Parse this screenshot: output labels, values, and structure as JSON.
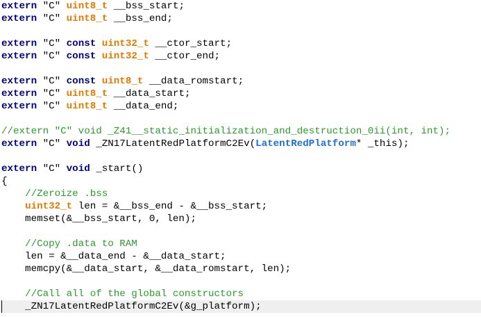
{
  "editor": {
    "current_line": 24,
    "lines": [
      [
        {
          "t": "extern",
          "c": "kw"
        },
        {
          "t": " \"C\" ",
          "c": "str"
        },
        {
          "t": "uint8_t",
          "c": "type"
        },
        {
          "t": " __bss_start;",
          "c": "plain"
        }
      ],
      [
        {
          "t": "extern",
          "c": "kw"
        },
        {
          "t": " \"C\" ",
          "c": "str"
        },
        {
          "t": "uint8_t",
          "c": "type"
        },
        {
          "t": " __bss_end;",
          "c": "plain"
        }
      ],
      [],
      [
        {
          "t": "extern",
          "c": "kw"
        },
        {
          "t": " \"C\" ",
          "c": "str"
        },
        {
          "t": "const",
          "c": "kw"
        },
        {
          "t": " ",
          "c": "plain"
        },
        {
          "t": "uint32_t",
          "c": "type"
        },
        {
          "t": " __ctor_start;",
          "c": "plain"
        }
      ],
      [
        {
          "t": "extern",
          "c": "kw"
        },
        {
          "t": " \"C\" ",
          "c": "str"
        },
        {
          "t": "const",
          "c": "kw"
        },
        {
          "t": " ",
          "c": "plain"
        },
        {
          "t": "uint32_t",
          "c": "type"
        },
        {
          "t": " __ctor_end;",
          "c": "plain"
        }
      ],
      [],
      [
        {
          "t": "extern",
          "c": "kw"
        },
        {
          "t": " \"C\" ",
          "c": "str"
        },
        {
          "t": "const",
          "c": "kw"
        },
        {
          "t": " ",
          "c": "plain"
        },
        {
          "t": "uint8_t",
          "c": "type"
        },
        {
          "t": " __data_romstart;",
          "c": "plain"
        }
      ],
      [
        {
          "t": "extern",
          "c": "kw"
        },
        {
          "t": " \"C\" ",
          "c": "str"
        },
        {
          "t": "uint8_t",
          "c": "type"
        },
        {
          "t": " __data_start;",
          "c": "plain"
        }
      ],
      [
        {
          "t": "extern",
          "c": "kw"
        },
        {
          "t": " \"C\" ",
          "c": "str"
        },
        {
          "t": "uint8_t",
          "c": "type"
        },
        {
          "t": " __data_end;",
          "c": "plain"
        }
      ],
      [],
      [
        {
          "t": "//extern \"C\" void _Z41__static_initialization_and_destruction_0ii(int, int);",
          "c": "com"
        }
      ],
      [
        {
          "t": "extern",
          "c": "kw"
        },
        {
          "t": " \"C\" ",
          "c": "str"
        },
        {
          "t": "void",
          "c": "kw"
        },
        {
          "t": " _ZN17LatentRedPlatformC2Ev(",
          "c": "plain"
        },
        {
          "t": "LatentRedPlatform",
          "c": "cls"
        },
        {
          "t": "* _this);",
          "c": "plain"
        }
      ],
      [],
      [
        {
          "t": "extern",
          "c": "kw"
        },
        {
          "t": " \"C\" ",
          "c": "str"
        },
        {
          "t": "void",
          "c": "kw"
        },
        {
          "t": " _start()",
          "c": "plain"
        }
      ],
      [
        {
          "t": "{",
          "c": "plain"
        }
      ],
      [
        {
          "t": "    ",
          "c": "plain"
        },
        {
          "t": "//Zeroize .bss",
          "c": "com"
        }
      ],
      [
        {
          "t": "    ",
          "c": "plain"
        },
        {
          "t": "uint32_t",
          "c": "type"
        },
        {
          "t": " len = &__bss_end - &__bss_start;",
          "c": "plain"
        }
      ],
      [
        {
          "t": "    memset(&__bss_start, 0, len);",
          "c": "plain"
        }
      ],
      [],
      [
        {
          "t": "    ",
          "c": "plain"
        },
        {
          "t": "//Copy .data to RAM",
          "c": "com"
        }
      ],
      [
        {
          "t": "    len = &__data_end - &__data_start;",
          "c": "plain"
        }
      ],
      [
        {
          "t": "    memcpy(&__data_start, &__data_romstart, len);",
          "c": "plain"
        }
      ],
      [],
      [
        {
          "t": "    ",
          "c": "plain"
        },
        {
          "t": "//Call all of the global constructors",
          "c": "com"
        }
      ],
      [
        {
          "t": "    _ZN17LatentRedPlatformC2Ev(&g_platform);",
          "c": "plain"
        }
      ]
    ]
  }
}
